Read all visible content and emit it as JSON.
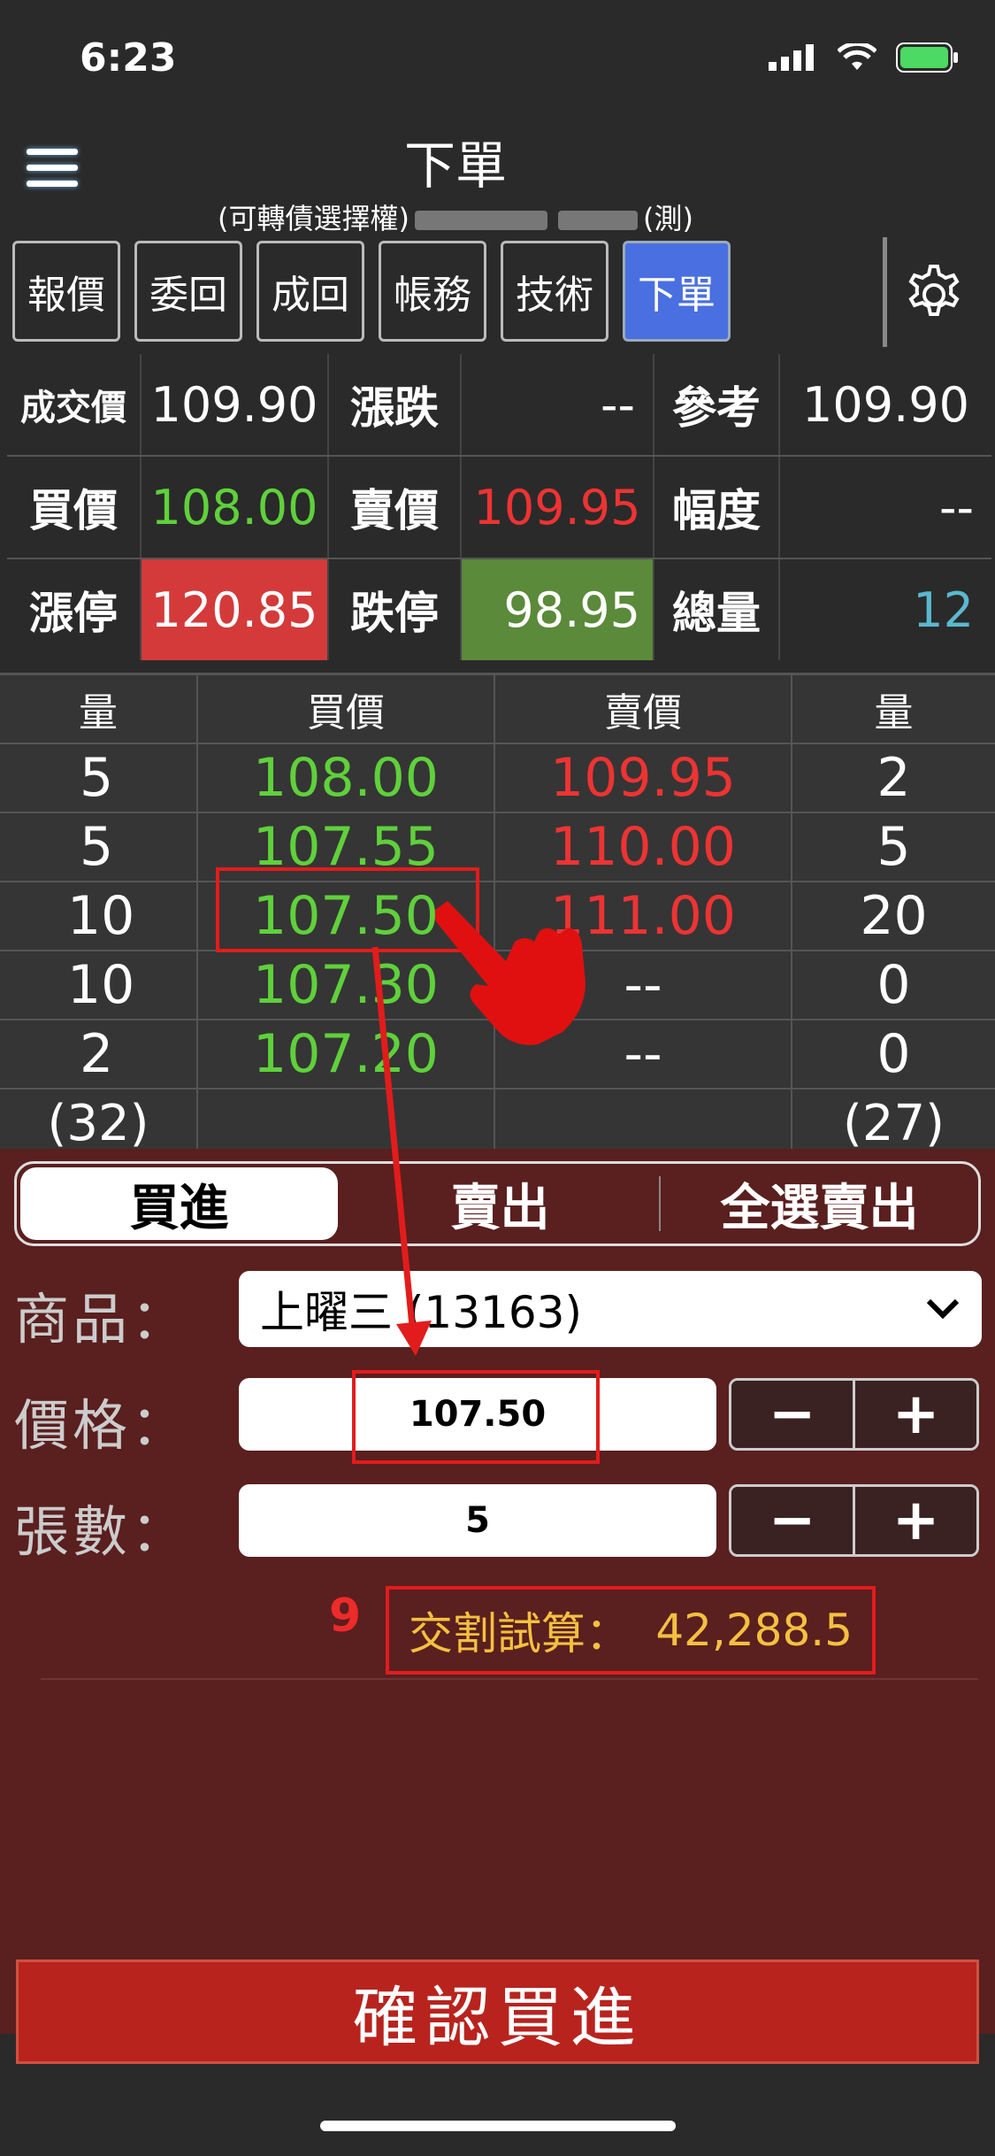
{
  "status": {
    "time": "6:23"
  },
  "header": {
    "title": "下單",
    "subtitle_prefix": "(可轉債選擇權)",
    "subtitle_suffix": "(測)"
  },
  "tabs": [
    {
      "label": "報價",
      "active": false
    },
    {
      "label": "委回",
      "active": false
    },
    {
      "label": "成回",
      "active": false
    },
    {
      "label": "帳務",
      "active": false
    },
    {
      "label": "技術",
      "active": false
    },
    {
      "label": "下單",
      "active": true
    }
  ],
  "quote": {
    "row1": {
      "l1": "成交價",
      "v1": "109.90",
      "l2": "漲跌",
      "v2": "--",
      "l3": "參考",
      "v3": "109.90"
    },
    "row2": {
      "l1": "買價",
      "v1": "108.00",
      "l2": "賣價",
      "v2": "109.95",
      "l3": "幅度",
      "v3": "--"
    },
    "row3": {
      "l1": "漲停",
      "v1": "120.85",
      "l2": "跌停",
      "v2": "98.95",
      "l3": "總量",
      "v3": "12"
    }
  },
  "book": {
    "headers": [
      "量",
      "買價",
      "賣價",
      "量"
    ],
    "rows": [
      [
        "5",
        "108.00",
        "109.95",
        "2"
      ],
      [
        "5",
        "107.55",
        "110.00",
        "5"
      ],
      [
        "10",
        "107.50",
        "111.00",
        "20"
      ],
      [
        "10",
        "107.30",
        "--",
        "0"
      ],
      [
        "2",
        "107.20",
        "--",
        "0"
      ]
    ],
    "totals": {
      "bid": "(32)",
      "ask": "(27)"
    }
  },
  "order": {
    "seg": [
      "買進",
      "賣出",
      "全選賣出"
    ],
    "product_label": "商品：",
    "product_value": "上曜三 (13163)",
    "price_label": "價格：",
    "price_value": "107.50",
    "qty_label": "張數：",
    "qty_value": "5",
    "minus": "−",
    "plus": "+",
    "annotation_number": "9",
    "settle_label": "交割試算：",
    "settle_value": "42,288.5",
    "confirm": "確認買進"
  },
  "colors": {
    "accent_tab": "#4a6fe0",
    "panel": "#5a1f1f",
    "confirm": "#b8231e",
    "bid": "#5fd13b",
    "ask": "#ee3333"
  }
}
